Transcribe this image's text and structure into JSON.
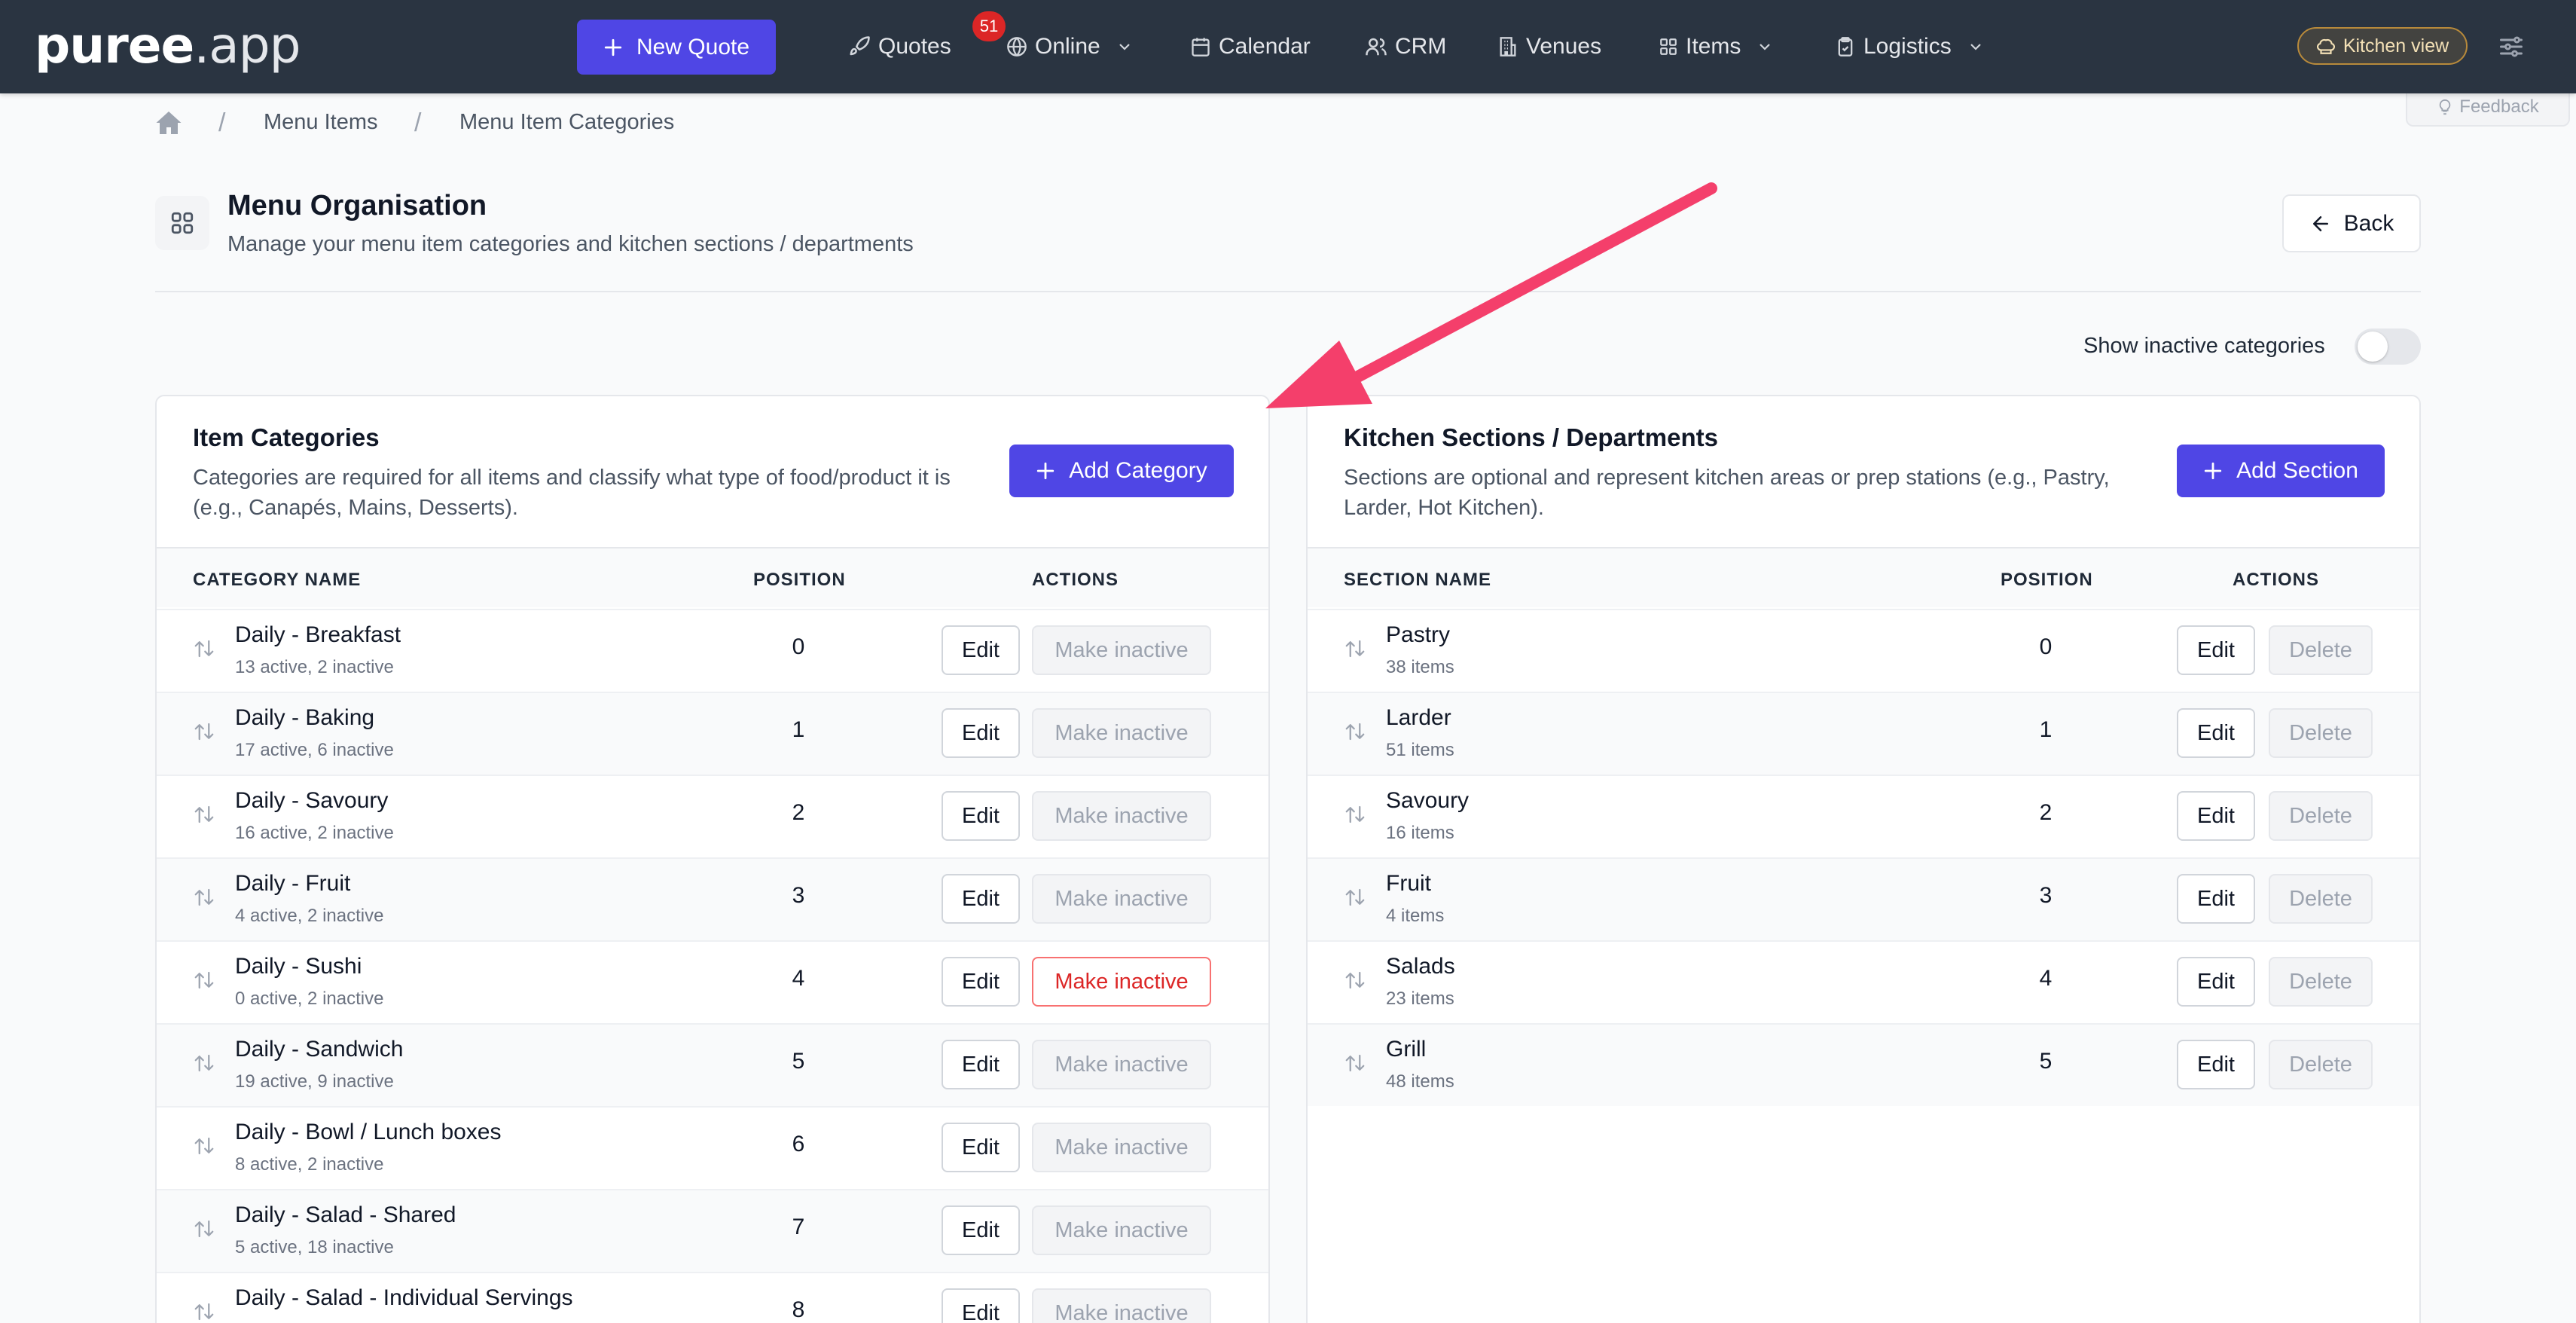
{
  "nav": {
    "logo_bold": "puree",
    "logo_light": ".app",
    "new_quote_label": "New Quote",
    "quotes_label": "Quotes",
    "quotes_badge": "51",
    "online_label": "Online",
    "calendar_label": "Calendar",
    "crm_label": "CRM",
    "venues_label": "Venues",
    "items_label": "Items",
    "logistics_label": "Logistics",
    "kitchen_view_label": "Kitchen view"
  },
  "breadcrumb": {
    "items": [
      "Menu Items",
      "Menu Item Categories"
    ]
  },
  "feedback_label": "Feedback",
  "header": {
    "title": "Menu Organisation",
    "subtitle": "Manage your menu item categories and kitchen sections / departments",
    "back_label": "Back"
  },
  "toggle": {
    "label": "Show inactive categories",
    "on": false
  },
  "categories": {
    "title": "Item Categories",
    "description_line1": "Categories are required for all items and classify what type of food/product it is",
    "description_line2": "(e.g., Canapés, Mains, Desserts).",
    "add_label": "Add Category",
    "columns": [
      "CATEGORY NAME",
      "POSITION",
      "ACTIONS"
    ],
    "edit_label": "Edit",
    "inactive_label": "Make inactive",
    "rows": [
      {
        "name": "Daily - Breakfast",
        "meta": "13 active, 2 inactive",
        "position": "0"
      },
      {
        "name": "Daily - Baking",
        "meta": "17 active, 6 inactive",
        "position": "1"
      },
      {
        "name": "Daily - Savoury",
        "meta": "16 active, 2 inactive",
        "position": "2"
      },
      {
        "name": "Daily - Fruit",
        "meta": "4 active, 2 inactive",
        "position": "3"
      },
      {
        "name": "Daily - Sushi",
        "meta": "0 active, 2 inactive",
        "position": "4"
      },
      {
        "name": "Daily - Sandwich",
        "meta": "19 active, 9 inactive",
        "position": "5"
      },
      {
        "name": "Daily - Bowl / Lunch boxes",
        "meta": "8 active, 2 inactive",
        "position": "6"
      },
      {
        "name": "Daily - Salad - Shared",
        "meta": "5 active, 18 inactive",
        "position": "7"
      },
      {
        "name": "Daily - Salad - Individual Servings",
        "meta": "",
        "position": "8"
      }
    ]
  },
  "sections": {
    "title": "Kitchen Sections / Departments",
    "description_line1": "Sections are optional and represent kitchen areas or prep stations (e.g., Pastry,",
    "description_line2": "Larder, Hot Kitchen).",
    "add_label": "Add Section",
    "columns": [
      "SECTION NAME",
      "POSITION",
      "ACTIONS"
    ],
    "edit_label": "Edit",
    "delete_label": "Delete",
    "rows": [
      {
        "name": "Pastry",
        "meta": "38 items",
        "position": "0"
      },
      {
        "name": "Larder",
        "meta": "51 items",
        "position": "1"
      },
      {
        "name": "Savoury",
        "meta": "16 items",
        "position": "2"
      },
      {
        "name": "Fruit",
        "meta": "4 items",
        "position": "3"
      },
      {
        "name": "Salads",
        "meta": "23 items",
        "position": "4"
      },
      {
        "name": "Grill",
        "meta": "48 items",
        "position": "5"
      }
    ]
  },
  "colors": {
    "nav_bg": "#2a3441",
    "primary": "#4f46e5",
    "danger": "#dc2626",
    "annotation_arrow": "#f43f6b"
  }
}
